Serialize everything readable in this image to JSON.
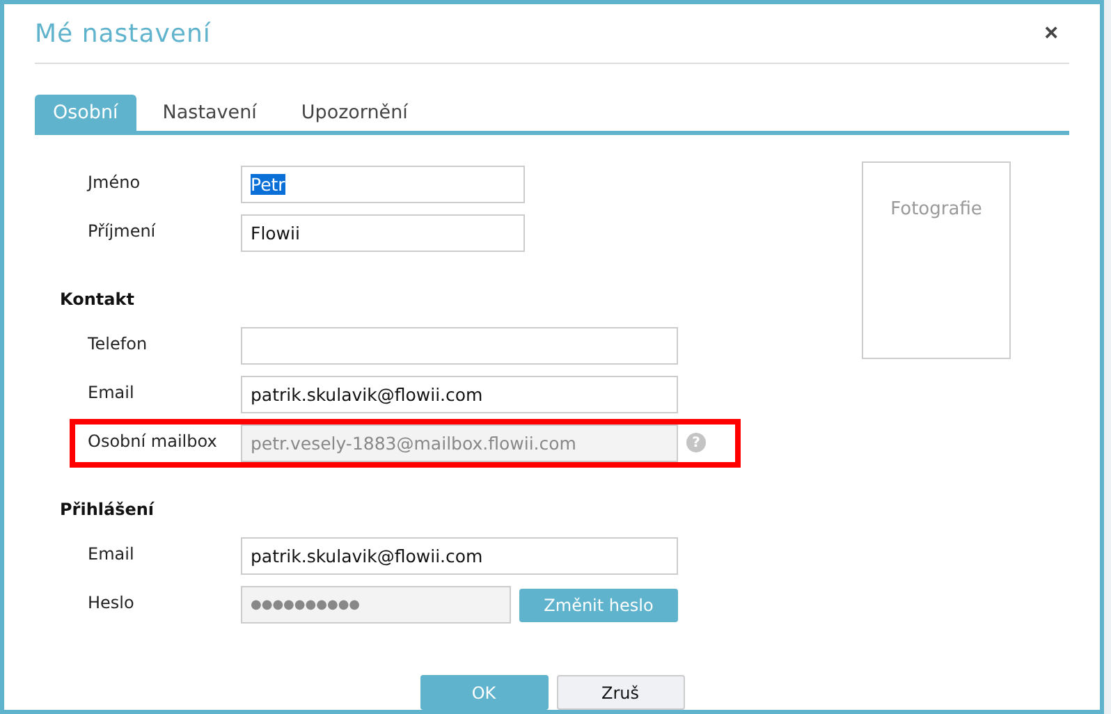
{
  "dialog": {
    "title": "Mé nastavení",
    "close": "×"
  },
  "tabs": [
    {
      "label": "Osobní",
      "selected": true
    },
    {
      "label": "Nastavení",
      "selected": false
    },
    {
      "label": "Upozornění",
      "selected": false
    }
  ],
  "sections": [
    {
      "fields": [
        {
          "kind": "text",
          "label": "Jméno",
          "value": "Petr",
          "text_selected": true,
          "wide": false,
          "highlighted": false
        },
        {
          "kind": "text",
          "label": "Příjmení",
          "value": "Flowii",
          "text_selected": false,
          "wide": false,
          "highlighted": false
        }
      ]
    },
    {
      "heading": "Kontakt",
      "fields": [
        {
          "kind": "text",
          "label": "Telefon",
          "wide": true,
          "highlighted": false
        },
        {
          "kind": "text",
          "label": "Email",
          "value": "patrik.skulavik@flowii.com",
          "text_selected": false,
          "wide": true,
          "highlighted": false
        },
        {
          "kind": "readonly",
          "label": "Osobní mailbox",
          "value": "petr.vesely-1883@mailbox.flowii.com",
          "text_selected": false,
          "wide": true,
          "highlighted": true,
          "help": "?"
        }
      ]
    },
    {
      "heading": "Přihlášení",
      "fields": [
        {
          "kind": "text",
          "label": "Email",
          "value": "patrik.skulavik@flowii.com",
          "text_selected": false,
          "wide": true,
          "highlighted": false
        },
        {
          "kind": "password",
          "label": "Heslo",
          "value": "●●●●●●●●●●",
          "text_selected": false,
          "wide": false,
          "highlighted": false,
          "action": "Změnit heslo"
        }
      ]
    }
  ],
  "photo": {
    "label": "Fotografie"
  },
  "buttons": [
    {
      "label": "OK",
      "primary": true
    },
    {
      "label": "Zruš",
      "primary": false
    }
  ]
}
